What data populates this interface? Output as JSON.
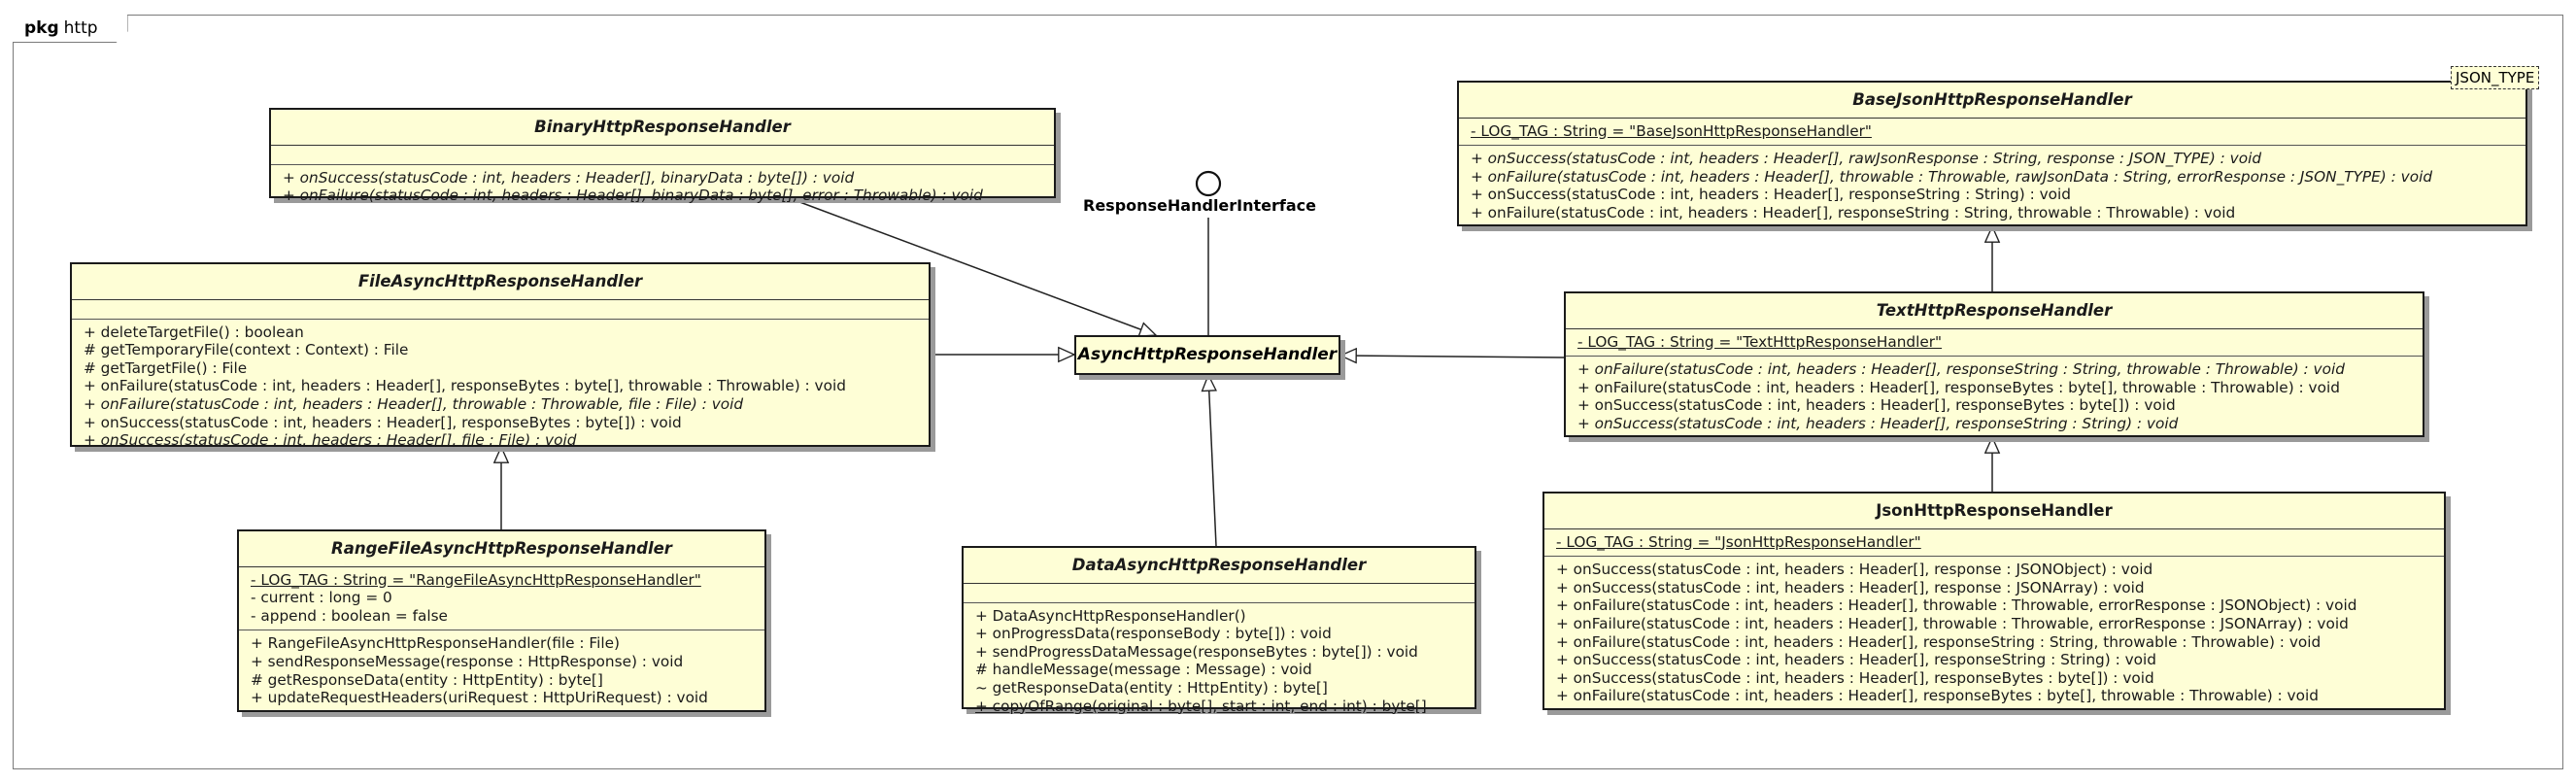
{
  "package": {
    "keyword": "pkg",
    "name": "http"
  },
  "interface": {
    "name": "ResponseHandlerInterface"
  },
  "abstract_handler": {
    "name": "AsyncHttpResponseHandler"
  },
  "template_param": "JSON_TYPE",
  "classes": {
    "binary": {
      "name": "BinaryHttpResponseHandler",
      "attributes": [],
      "methods": [
        "+ onSuccess(statusCode : int, headers : Header[], binaryData : byte[]) : void",
        "+ onFailure(statusCode : int, headers : Header[], binaryData : byte[], error : Throwable) : void"
      ]
    },
    "file": {
      "name": "FileAsyncHttpResponseHandler",
      "attributes": [],
      "methods": [
        "+ deleteTargetFile() : boolean",
        "# getTemporaryFile(context : Context) : File",
        "# getTargetFile() : File",
        "+ onFailure(statusCode : int, headers : Header[], responseBytes : byte[], throwable : Throwable) : void",
        "+ onFailure(statusCode : int, headers : Header[], throwable : Throwable, file : File) : void",
        "+ onSuccess(statusCode : int, headers : Header[], responseBytes : byte[]) : void",
        "+ onSuccess(statusCode : int, headers : Header[], file : File) : void"
      ]
    },
    "range": {
      "name": "RangeFileAsyncHttpResponseHandler",
      "attributes": [
        "- LOG_TAG : String = \"RangeFileAsyncHttpResponseHandler\"",
        "- current : long = 0",
        "- append : boolean = false"
      ],
      "methods": [
        "+ RangeFileAsyncHttpResponseHandler(file : File)",
        "+ sendResponseMessage(response : HttpResponse) : void",
        "# getResponseData(entity : HttpEntity) : byte[]",
        "+ updateRequestHeaders(uriRequest : HttpUriRequest) : void"
      ]
    },
    "data": {
      "name": "DataAsyncHttpResponseHandler",
      "attributes": [],
      "methods": [
        "+ DataAsyncHttpResponseHandler()",
        "+ onProgressData(responseBody : byte[]) : void",
        "+ sendProgressDataMessage(responseBytes : byte[]) : void",
        "# handleMessage(message : Message) : void",
        "~ getResponseData(entity : HttpEntity) : byte[]",
        "+ copyOfRange(original : byte[], start : int, end : int) : byte[]"
      ]
    },
    "basejson": {
      "name": "BaseJsonHttpResponseHandler",
      "attributes": [
        "- LOG_TAG : String = \"BaseJsonHttpResponseHandler\""
      ],
      "methods": [
        "+ onSuccess(statusCode : int, headers : Header[], rawJsonResponse : String, response : JSON_TYPE) : void",
        "+ onFailure(statusCode : int, headers : Header[], throwable : Throwable, rawJsonData : String, errorResponse : JSON_TYPE) : void",
        "+ onSuccess(statusCode : int, headers : Header[], responseString : String) : void",
        "+ onFailure(statusCode : int, headers : Header[], responseString : String, throwable : Throwable) : void"
      ]
    },
    "text": {
      "name": "TextHttpResponseHandler",
      "attributes": [
        "- LOG_TAG : String = \"TextHttpResponseHandler\""
      ],
      "methods": [
        "+ onFailure(statusCode : int, headers : Header[], responseString : String, throwable : Throwable) : void",
        "+ onFailure(statusCode : int, headers : Header[], responseBytes : byte[], throwable : Throwable) : void",
        "+ onSuccess(statusCode : int, headers : Header[], responseBytes : byte[]) : void",
        "+ onSuccess(statusCode : int, headers : Header[], responseString : String) : void"
      ]
    },
    "json": {
      "name": "JsonHttpResponseHandler",
      "attributes": [
        "- LOG_TAG : String = \"JsonHttpResponseHandler\""
      ],
      "methods": [
        "+ onSuccess(statusCode : int, headers : Header[], response : JSONObject) : void",
        "+ onSuccess(statusCode : int, headers : Header[], response : JSONArray) : void",
        "+ onFailure(statusCode : int, headers : Header[], throwable : Throwable, errorResponse : JSONObject) : void",
        "+ onFailure(statusCode : int, headers : Header[], throwable : Throwable, errorResponse : JSONArray) : void",
        "+ onFailure(statusCode : int, headers : Header[], responseString : String, throwable : Throwable) : void",
        "+ onSuccess(statusCode : int, headers : Header[], responseString : String) : void",
        "+ onSuccess(statusCode : int, headers : Header[], responseBytes : byte[]) : void",
        "+ onFailure(statusCode : int, headers : Header[], responseBytes : byte[], throwable : Throwable) : void"
      ]
    }
  }
}
